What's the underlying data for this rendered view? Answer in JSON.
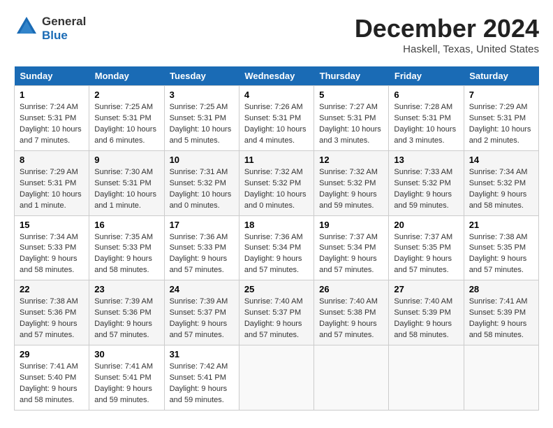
{
  "header": {
    "logo_line1": "General",
    "logo_line2": "Blue",
    "month": "December 2024",
    "location": "Haskell, Texas, United States"
  },
  "weekdays": [
    "Sunday",
    "Monday",
    "Tuesday",
    "Wednesday",
    "Thursday",
    "Friday",
    "Saturday"
  ],
  "weeks": [
    [
      {
        "day": 1,
        "sunrise": "7:24 AM",
        "sunset": "5:31 PM",
        "daylight": "10 hours and 7 minutes."
      },
      {
        "day": 2,
        "sunrise": "7:25 AM",
        "sunset": "5:31 PM",
        "daylight": "10 hours and 6 minutes."
      },
      {
        "day": 3,
        "sunrise": "7:25 AM",
        "sunset": "5:31 PM",
        "daylight": "10 hours and 5 minutes."
      },
      {
        "day": 4,
        "sunrise": "7:26 AM",
        "sunset": "5:31 PM",
        "daylight": "10 hours and 4 minutes."
      },
      {
        "day": 5,
        "sunrise": "7:27 AM",
        "sunset": "5:31 PM",
        "daylight": "10 hours and 3 minutes."
      },
      {
        "day": 6,
        "sunrise": "7:28 AM",
        "sunset": "5:31 PM",
        "daylight": "10 hours and 3 minutes."
      },
      {
        "day": 7,
        "sunrise": "7:29 AM",
        "sunset": "5:31 PM",
        "daylight": "10 hours and 2 minutes."
      }
    ],
    [
      {
        "day": 8,
        "sunrise": "7:29 AM",
        "sunset": "5:31 PM",
        "daylight": "10 hours and 1 minute."
      },
      {
        "day": 9,
        "sunrise": "7:30 AM",
        "sunset": "5:31 PM",
        "daylight": "10 hours and 1 minute."
      },
      {
        "day": 10,
        "sunrise": "7:31 AM",
        "sunset": "5:32 PM",
        "daylight": "10 hours and 0 minutes."
      },
      {
        "day": 11,
        "sunrise": "7:32 AM",
        "sunset": "5:32 PM",
        "daylight": "10 hours and 0 minutes."
      },
      {
        "day": 12,
        "sunrise": "7:32 AM",
        "sunset": "5:32 PM",
        "daylight": "9 hours and 59 minutes."
      },
      {
        "day": 13,
        "sunrise": "7:33 AM",
        "sunset": "5:32 PM",
        "daylight": "9 hours and 59 minutes."
      },
      {
        "day": 14,
        "sunrise": "7:34 AM",
        "sunset": "5:32 PM",
        "daylight": "9 hours and 58 minutes."
      }
    ],
    [
      {
        "day": 15,
        "sunrise": "7:34 AM",
        "sunset": "5:33 PM",
        "daylight": "9 hours and 58 minutes."
      },
      {
        "day": 16,
        "sunrise": "7:35 AM",
        "sunset": "5:33 PM",
        "daylight": "9 hours and 58 minutes."
      },
      {
        "day": 17,
        "sunrise": "7:36 AM",
        "sunset": "5:33 PM",
        "daylight": "9 hours and 57 minutes."
      },
      {
        "day": 18,
        "sunrise": "7:36 AM",
        "sunset": "5:34 PM",
        "daylight": "9 hours and 57 minutes."
      },
      {
        "day": 19,
        "sunrise": "7:37 AM",
        "sunset": "5:34 PM",
        "daylight": "9 hours and 57 minutes."
      },
      {
        "day": 20,
        "sunrise": "7:37 AM",
        "sunset": "5:35 PM",
        "daylight": "9 hours and 57 minutes."
      },
      {
        "day": 21,
        "sunrise": "7:38 AM",
        "sunset": "5:35 PM",
        "daylight": "9 hours and 57 minutes."
      }
    ],
    [
      {
        "day": 22,
        "sunrise": "7:38 AM",
        "sunset": "5:36 PM",
        "daylight": "9 hours and 57 minutes."
      },
      {
        "day": 23,
        "sunrise": "7:39 AM",
        "sunset": "5:36 PM",
        "daylight": "9 hours and 57 minutes."
      },
      {
        "day": 24,
        "sunrise": "7:39 AM",
        "sunset": "5:37 PM",
        "daylight": "9 hours and 57 minutes."
      },
      {
        "day": 25,
        "sunrise": "7:40 AM",
        "sunset": "5:37 PM",
        "daylight": "9 hours and 57 minutes."
      },
      {
        "day": 26,
        "sunrise": "7:40 AM",
        "sunset": "5:38 PM",
        "daylight": "9 hours and 57 minutes."
      },
      {
        "day": 27,
        "sunrise": "7:40 AM",
        "sunset": "5:39 PM",
        "daylight": "9 hours and 58 minutes."
      },
      {
        "day": 28,
        "sunrise": "7:41 AM",
        "sunset": "5:39 PM",
        "daylight": "9 hours and 58 minutes."
      }
    ],
    [
      {
        "day": 29,
        "sunrise": "7:41 AM",
        "sunset": "5:40 PM",
        "daylight": "9 hours and 58 minutes."
      },
      {
        "day": 30,
        "sunrise": "7:41 AM",
        "sunset": "5:41 PM",
        "daylight": "9 hours and 59 minutes."
      },
      {
        "day": 31,
        "sunrise": "7:42 AM",
        "sunset": "5:41 PM",
        "daylight": "9 hours and 59 minutes."
      },
      null,
      null,
      null,
      null
    ]
  ]
}
